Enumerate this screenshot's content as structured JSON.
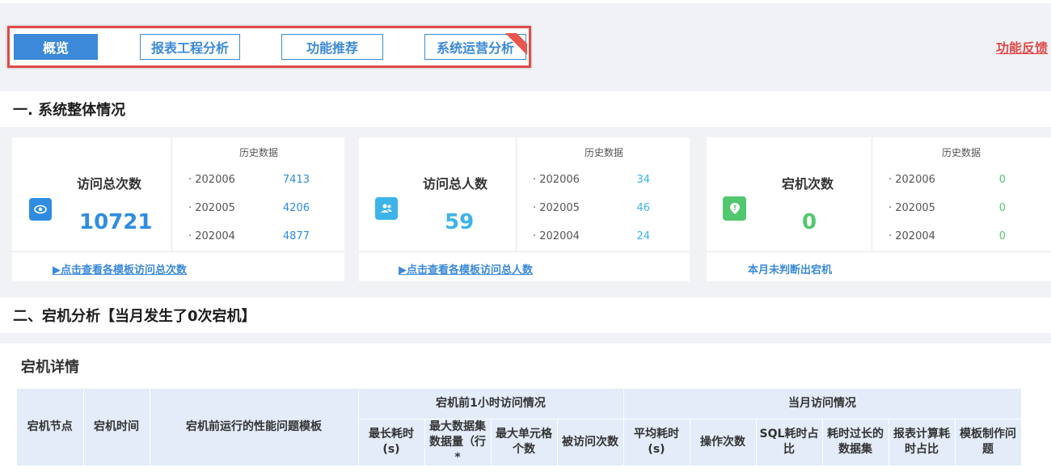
{
  "tabs": [
    {
      "label": "概览",
      "active": true
    },
    {
      "label": "报表工程分析",
      "active": false
    },
    {
      "label": "功能推荐",
      "active": false
    },
    {
      "label": "系统运营分析",
      "active": false
    }
  ],
  "feedback_label": "功能反馈",
  "section1_title": "一. 系统整体情况",
  "cards": [
    {
      "title": "访问总次数",
      "value": "10721",
      "value_color": "#2f8ce0",
      "icon": "eye-icon",
      "icon_color": "#2f8ce0",
      "history_title": "历史数据",
      "history": [
        {
          "period": "· 202006",
          "value": "7413"
        },
        {
          "period": "· 202005",
          "value": "4206"
        },
        {
          "period": "· 202004",
          "value": "4877"
        }
      ],
      "history_value_color": "#2f8ce0",
      "footer": "▶点击查看各模板访问总次数"
    },
    {
      "title": "访问总人数",
      "value": "59",
      "value_color": "#3cb4ea",
      "icon": "users-icon",
      "icon_color": "#3cb4ea",
      "history_title": "历史数据",
      "history": [
        {
          "period": "· 202006",
          "value": "34"
        },
        {
          "period": "· 202005",
          "value": "46"
        },
        {
          "period": "· 202004",
          "value": "24"
        }
      ],
      "history_value_color": "#3cb4ea",
      "footer": "▶点击查看各模板访问总人数"
    },
    {
      "title": "宕机次数",
      "value": "0",
      "value_color": "#52c76f",
      "icon": "alert-pin-icon",
      "icon_color": "#52c76f",
      "history_title": "历史数据",
      "history": [
        {
          "period": "· 202006",
          "value": "0"
        },
        {
          "period": "· 202005",
          "value": "0"
        },
        {
          "period": "· 202004",
          "value": "0"
        }
      ],
      "history_value_color": "#52c76f",
      "footer": "本月未判断出宕机"
    }
  ],
  "section2_title": "二、宕机分析【当月发生了0次宕机】",
  "detail": {
    "title": "宕机详情",
    "headers": {
      "node": "宕机节点",
      "time": "宕机时间",
      "template": "宕机前运行的性能问题模板",
      "group_before": "宕机前1小时访问情况",
      "group_month": "当月访问情况",
      "max_time": "最长耗时(s)",
      "max_dataset": "最大数据集数据量（行*",
      "max_cells": "最大单元格个数",
      "visits": "被访问次数",
      "avg_time": "平均耗时(s)",
      "ops": "操作次数",
      "sql_ratio": "SQL耗时占比",
      "slow_dataset": "耗时过长的数据集",
      "calc_ratio": "报表计算耗时占比",
      "template_issue": "模板制作问题"
    }
  }
}
